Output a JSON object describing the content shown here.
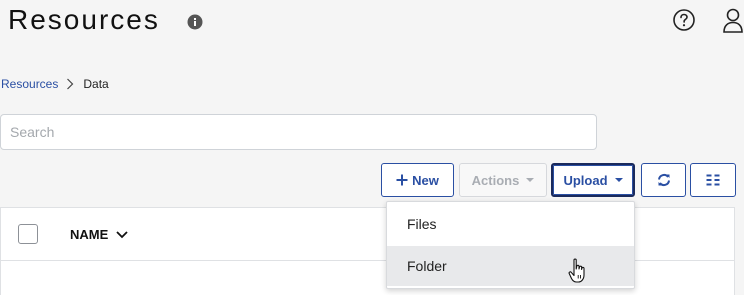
{
  "header": {
    "title": "Resources",
    "info_icon": "info-circle-icon",
    "help_icon": "question-circle-icon",
    "user_icon": "user-icon"
  },
  "breadcrumb": {
    "items": [
      {
        "label": "Resources",
        "link": true
      },
      {
        "label": "Data",
        "link": false
      }
    ]
  },
  "search": {
    "placeholder": "Search",
    "value": ""
  },
  "toolbar": {
    "new_label": "New",
    "actions_label": "Actions",
    "upload_label": "Upload",
    "refresh_icon": "refresh-icon",
    "columns_icon": "columns-icon"
  },
  "table": {
    "columns": [
      {
        "label": "NAME",
        "sort": "descending"
      }
    ]
  },
  "upload_menu": {
    "items": [
      {
        "label": "Files",
        "hovered": false
      },
      {
        "label": "Folder",
        "hovered": true
      }
    ]
  },
  "colors": {
    "accent": "#2a4fa3",
    "disabled": "#a9adb3",
    "background": "#f5f5f5",
    "hover": "#e8e9eb"
  }
}
